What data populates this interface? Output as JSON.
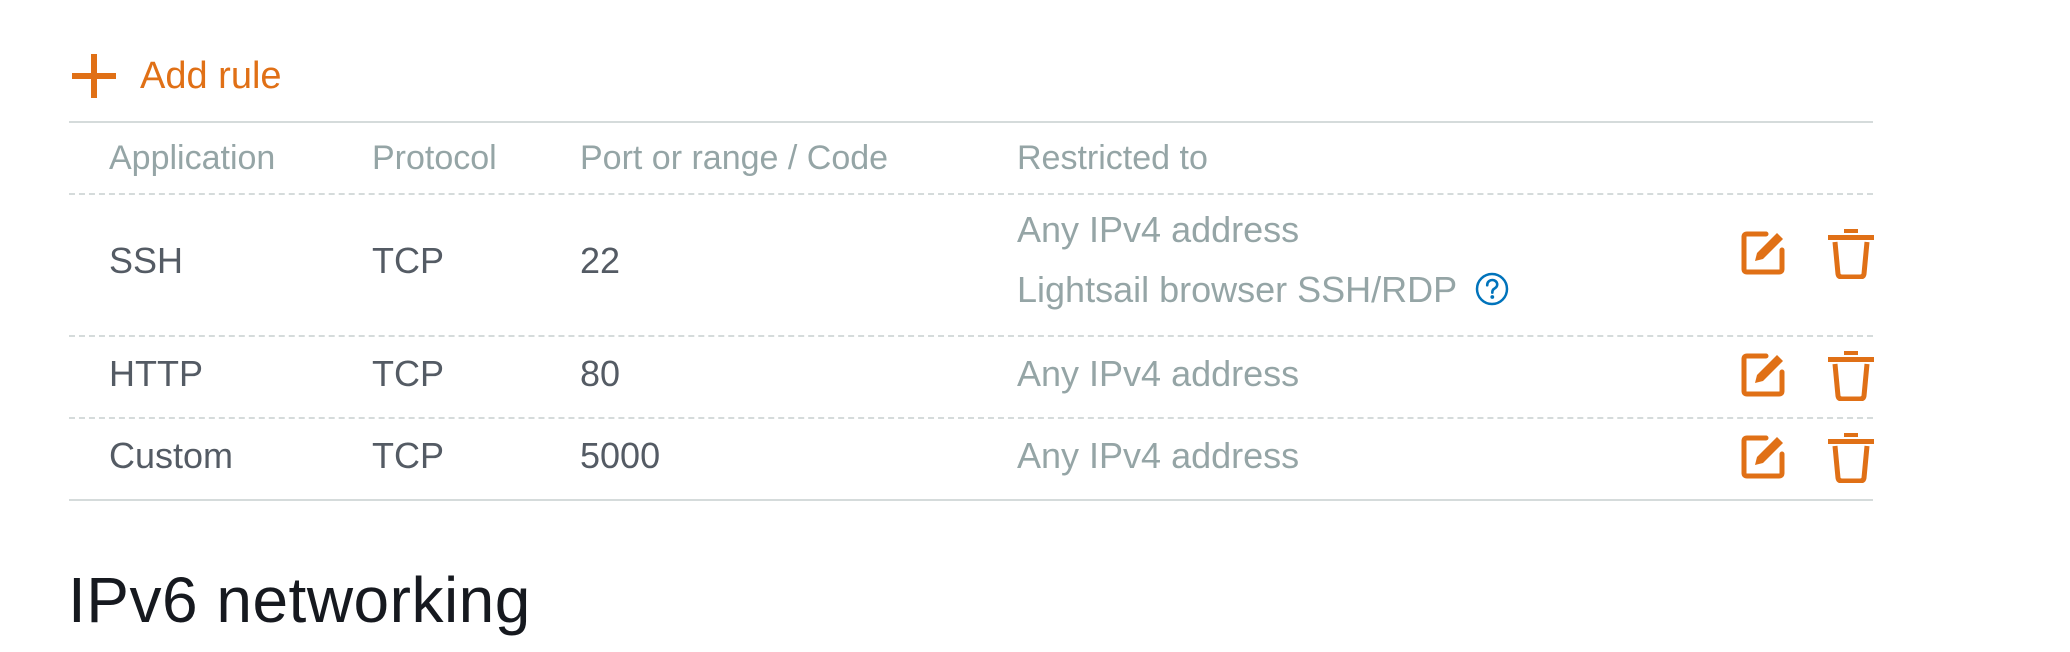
{
  "add_rule": {
    "label": "Add rule"
  },
  "table": {
    "headers": {
      "application": "Application",
      "protocol": "Protocol",
      "port": "Port or range / Code",
      "restricted": "Restricted to"
    },
    "rows": [
      {
        "application": "SSH",
        "protocol": "TCP",
        "port": "22",
        "restricted": [
          "Any IPv4 address",
          "Lightsail browser SSH/RDP"
        ]
      },
      {
        "application": "HTTP",
        "protocol": "TCP",
        "port": "80",
        "restricted": [
          "Any IPv4 address"
        ]
      },
      {
        "application": "Custom",
        "protocol": "TCP",
        "port": "5000",
        "restricted": [
          "Any IPv4 address"
        ]
      }
    ]
  },
  "ipv6_section": {
    "title": "IPv6 networking"
  },
  "colors": {
    "accent": "#e07016",
    "header_text": "#95a5a6",
    "cell_text": "#545b64",
    "divider": "#d5dbdb",
    "help_icon": "#0073bb"
  },
  "icons": {
    "add": "plus-icon",
    "edit": "edit-icon",
    "delete": "trash-icon",
    "help": "help-icon"
  }
}
